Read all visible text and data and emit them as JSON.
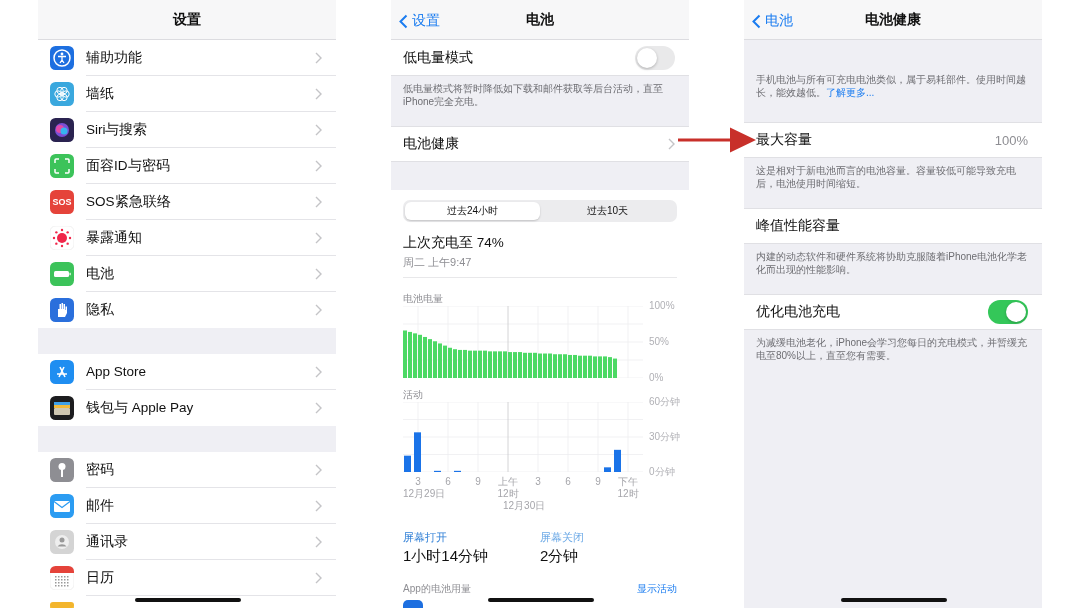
{
  "settings_screen": {
    "title": "设置",
    "groups": [
      {
        "items": [
          {
            "kind": "accessibility",
            "label": "辅助功能"
          },
          {
            "kind": "wallpaper",
            "label": "墙纸"
          },
          {
            "kind": "siri",
            "label": "Siri与搜索"
          },
          {
            "kind": "faceid",
            "label": "面容ID与密码"
          },
          {
            "kind": "sos",
            "icon_text": "SOS",
            "label": "SOS紧急联络"
          },
          {
            "kind": "exposure",
            "label": "暴露通知"
          },
          {
            "kind": "battery",
            "label": "电池"
          },
          {
            "kind": "privacy",
            "label": "隐私"
          }
        ]
      },
      {
        "items": [
          {
            "kind": "appstore",
            "label": "App Store"
          },
          {
            "kind": "wallet",
            "label": "钱包与 Apple Pay"
          }
        ]
      },
      {
        "items": [
          {
            "kind": "passwords",
            "label": "密码"
          },
          {
            "kind": "mail",
            "label": "邮件"
          },
          {
            "kind": "contacts",
            "label": "通讯录"
          },
          {
            "kind": "calendar",
            "label": "日历"
          },
          {
            "kind": "notes"
          }
        ]
      }
    ]
  },
  "battery_screen": {
    "back": "设置",
    "title": "电池",
    "low_power": {
      "label": "低电量模式",
      "on": false
    },
    "low_power_note": "低电量模式将暂时降低如下载和邮件获取等后台活动，直至iPhone完全充电。",
    "health_row": "电池健康",
    "segments": [
      {
        "label": "过去24小时",
        "selected": true
      },
      {
        "label": "过去10天",
        "selected": false
      }
    ],
    "last_charge": "上次充电至 74%",
    "last_charge_time": "周二 上午9:47",
    "battery_chart": {
      "chart_data": {
        "type": "bar",
        "title": "电池电量",
        "ylim": [
          0,
          100
        ],
        "grid": true,
        "yticks": [
          {
            "value": 0,
            "label": "0%"
          },
          {
            "value": 50,
            "label": "50%"
          },
          {
            "value": 100,
            "label": "100%"
          }
        ],
        "categories": [
          null,
          null,
          null,
          null,
          null,
          null,
          null,
          null,
          null,
          null,
          null,
          null,
          null,
          null,
          null,
          null,
          null,
          null,
          null,
          null,
          null,
          null,
          null,
          null,
          null,
          null,
          null,
          null,
          null,
          null,
          null,
          null,
          null,
          null,
          null,
          null,
          null,
          null,
          null,
          null,
          null,
          null,
          null,
          null,
          null,
          null,
          null,
          null
        ],
        "series": [
          {
            "color": "#4cd964",
            "values": [
              66,
              64,
              62,
              60,
              57,
              54,
              51,
              48,
              45,
              42,
              40,
              39,
              39,
              38,
              38,
              38,
              38,
              37,
              37,
              37,
              37,
              36,
              36,
              36,
              35,
              35,
              35,
              34,
              34,
              34,
              33,
              33,
              33,
              32,
              32,
              31,
              31,
              31,
              30,
              30,
              30,
              29,
              27,
              null,
              null,
              null,
              null,
              null
            ]
          }
        ]
      }
    },
    "activity_chart": {
      "chart_data": {
        "type": "bar",
        "title": "活动",
        "ylim": [
          0,
          60
        ],
        "grid": true,
        "yticks": [
          {
            "value": 0,
            "label": "0分钟"
          },
          {
            "value": 30,
            "label": "30分钟"
          },
          {
            "value": 60,
            "label": "60分钟"
          }
        ],
        "categories": [
          null,
          "3",
          null,
          null,
          "6",
          null,
          null,
          "9",
          null,
          null,
          "上午12时",
          null,
          null,
          "3",
          null,
          null,
          "6",
          null,
          null,
          "9",
          null,
          null,
          "下午12时",
          null
        ],
        "series": [
          {
            "color": "#1a73e8",
            "values": [
              14,
              34,
              null,
              1,
              null,
              1,
              null,
              null,
              null,
              null,
              null,
              null,
              null,
              null,
              null,
              null,
              null,
              null,
              null,
              null,
              4,
              19,
              null,
              null
            ]
          }
        ],
        "annotations": [
          "12月29日",
          "12月30日"
        ]
      }
    },
    "screen_on": {
      "label": "屏幕打开",
      "value": "1小时14分钟"
    },
    "screen_off": {
      "label": "屏幕关闭",
      "value": "2分钟"
    },
    "app_usage": "App的电池用量",
    "show_activity": "显示活动"
  },
  "battery_health_screen": {
    "back": "电池",
    "title": "电池健康",
    "intro": "手机电池与所有可充电电池类似，属于易耗部件。使用时间越长，能效越低。",
    "learn_more": "了解更多...",
    "max_capacity": {
      "label": "最大容量",
      "value": "100%"
    },
    "max_capacity_note": "这是相对于新电池而言的电池容量。容量较低可能导致充电后，电池使用时间缩短。",
    "peak": "峰值性能容量",
    "peak_note": "内建的动态软件和硬件系统将协助克服随着iPhone电池化学老化而出现的性能影响。",
    "optimized": {
      "label": "优化电池充电",
      "on": true
    },
    "optimized_note": "为减缓电池老化，iPhone会学习您每日的充电模式，并暂缓充电至80%以上，直至您有需要。"
  }
}
